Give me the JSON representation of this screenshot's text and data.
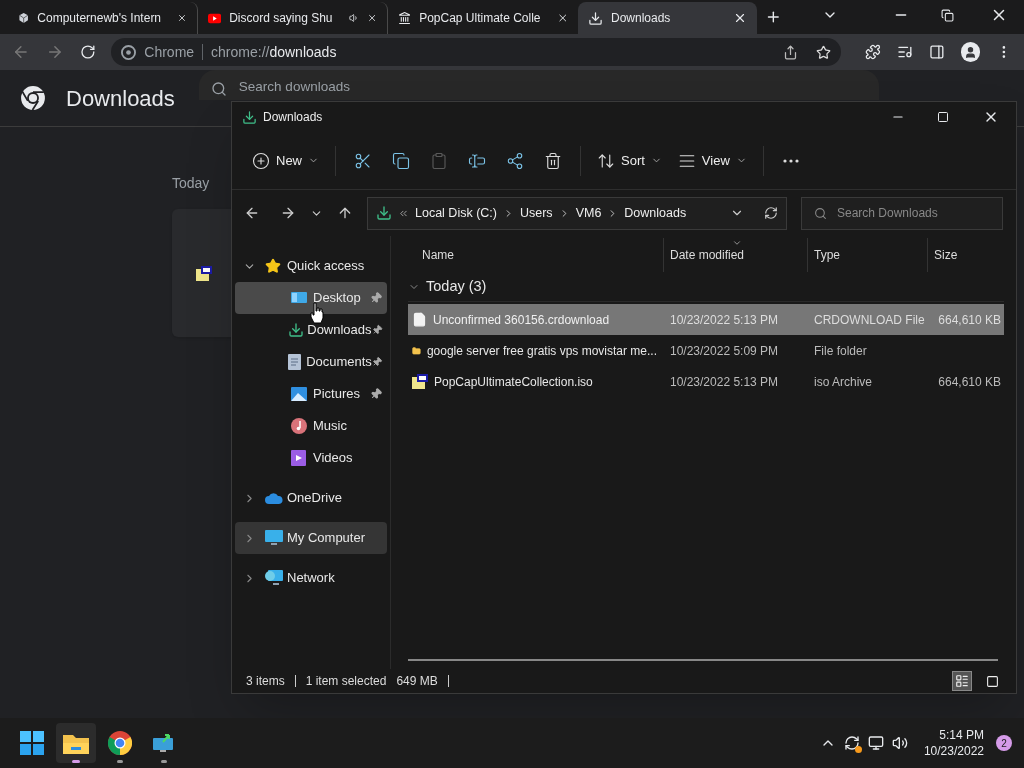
{
  "browser": {
    "tabs": [
      {
        "kind": "site",
        "title": "Computernewb's Intern",
        "audio": false,
        "selected": false
      },
      {
        "kind": "video",
        "title": "Discord saying Shu",
        "audio": true,
        "selected": false
      },
      {
        "kind": "museum",
        "title": "PopCap Ultimate Colle",
        "audio": false,
        "selected": false
      },
      {
        "kind": "download",
        "title": "Downloads",
        "audio": false,
        "selected": true
      }
    ],
    "omnibox": {
      "site_label": "Chrome",
      "url_scheme": "chrome://",
      "url_host": "downloads"
    },
    "page": {
      "title": "Downloads",
      "search_placeholder": "Search downloads",
      "group_label": "Today"
    }
  },
  "explorer": {
    "title": "Downloads",
    "commands": [
      {
        "kind": "new",
        "label": "New",
        "disabled": false
      },
      {
        "kind": "cut",
        "disabled": false
      },
      {
        "kind": "copy",
        "disabled": false
      },
      {
        "kind": "paste",
        "disabled": true
      },
      {
        "kind": "rename",
        "disabled": false
      },
      {
        "kind": "share",
        "disabled": false
      },
      {
        "kind": "delete",
        "disabled": false
      },
      {
        "kind": "sort",
        "label": "Sort",
        "disabled": false
      },
      {
        "kind": "view",
        "label": "View",
        "disabled": false
      },
      {
        "kind": "more",
        "disabled": false
      }
    ],
    "crumbs": [
      "Local Disk (C:)",
      "Users",
      "VM6",
      "Downloads"
    ],
    "search_placeholder": "Search Downloads",
    "nav": [
      {
        "kind": "star",
        "label": "Quick access",
        "expanded": true,
        "selected": false,
        "children": [
          {
            "kind": "desktop",
            "label": "Desktop",
            "pinned": true,
            "selected": true
          },
          {
            "kind": "download",
            "label": "Downloads",
            "pinned": true,
            "selected": false
          },
          {
            "kind": "document",
            "label": "Documents",
            "pinned": true,
            "selected": false
          },
          {
            "kind": "pictures",
            "label": "Pictures",
            "pinned": true,
            "selected": false
          },
          {
            "kind": "music",
            "label": "Music",
            "pinned": false,
            "selected": false
          },
          {
            "kind": "videos",
            "label": "Videos",
            "pinned": false,
            "selected": false
          }
        ]
      },
      {
        "kind": "cloud",
        "label": "OneDrive",
        "expanded": false,
        "selected": false
      },
      {
        "kind": "computer",
        "label": "My Computer",
        "expanded": false,
        "selected": true
      },
      {
        "kind": "network",
        "label": "Network",
        "expanded": false,
        "selected": false
      }
    ],
    "columns": [
      {
        "label": "Name",
        "sorted": false
      },
      {
        "label": "Date modified",
        "sorted": true
      },
      {
        "label": "Type",
        "sorted": false
      },
      {
        "label": "Size",
        "sorted": false
      }
    ],
    "groups": [
      {
        "label": "Today (3)",
        "expanded": true,
        "rows": [
          {
            "kind": "file",
            "name": "Unconfirmed 360156.crdownload",
            "date": "10/23/2022 5:13 PM",
            "type": "CRDOWNLOAD File",
            "size": "664,610 KB",
            "selected": true
          },
          {
            "kind": "folder",
            "name": "google server free gratis vps movistar me...",
            "date": "10/23/2022 5:09 PM",
            "type": "File folder",
            "selected": false
          },
          {
            "kind": "iso",
            "name": "PopCapUltimateCollection.iso",
            "date": "10/23/2022 5:13 PM",
            "type": "iso Archive",
            "size": "664,610 KB",
            "selected": false
          }
        ]
      }
    ],
    "status": {
      "count": "3 items",
      "selection": "1 item selected",
      "size": "649 MB"
    },
    "views": [
      {
        "kind": "details",
        "selected": true
      },
      {
        "kind": "tiles",
        "selected": false
      }
    ]
  },
  "taskbar": {
    "apps": [
      {
        "kind": "start",
        "running": false,
        "active": false
      },
      {
        "kind": "explorer",
        "running": true,
        "active": true
      },
      {
        "kind": "chrome",
        "running": true,
        "active": false
      },
      {
        "kind": "app",
        "running": true,
        "active": false
      }
    ],
    "clock": {
      "time": "5:14 PM",
      "date": "10/23/2022"
    },
    "notifications": "2"
  }
}
